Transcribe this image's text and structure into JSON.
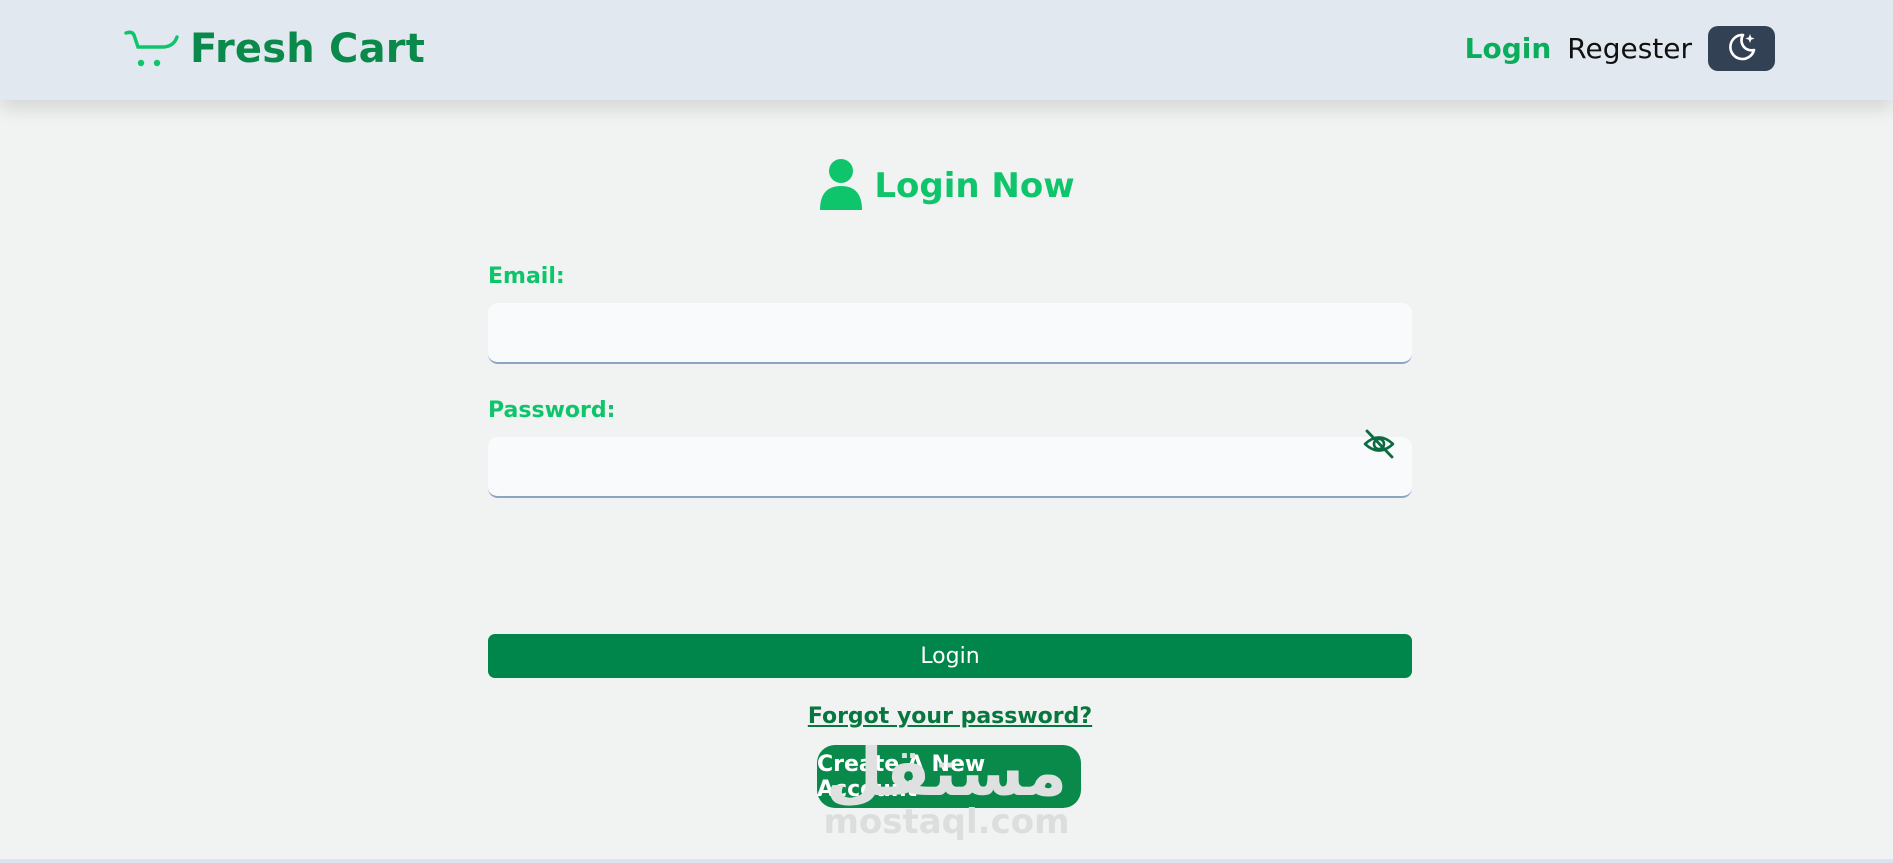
{
  "navbar": {
    "brand": {
      "name": "Fresh Cart",
      "icon": "cart-icon"
    },
    "links": {
      "login": "Login",
      "register": "Regester"
    },
    "theme_toggle": {
      "icon": "moon-icon"
    }
  },
  "page": {
    "heading": "Login Now",
    "heading_icon": "user-icon",
    "email": {
      "label": "Email:",
      "value": "",
      "placeholder": ""
    },
    "password": {
      "label": "Password:",
      "value": "",
      "placeholder": "",
      "toggle_icon": "eye-slash-icon"
    },
    "login_button": "Login",
    "forgot_link": "Forgot your password?",
    "create_account_button": "Create A New Account"
  },
  "watermark": {
    "arabic": "مستقل",
    "latin": "mostaql.com"
  },
  "colors": {
    "brand": "#0a8a4a",
    "accent": "#0fc56b",
    "button": "#00854a",
    "navbar_bg": "#e2e8f0",
    "page_bg": "#f1f2f2",
    "toggle_bg": "#334155"
  }
}
